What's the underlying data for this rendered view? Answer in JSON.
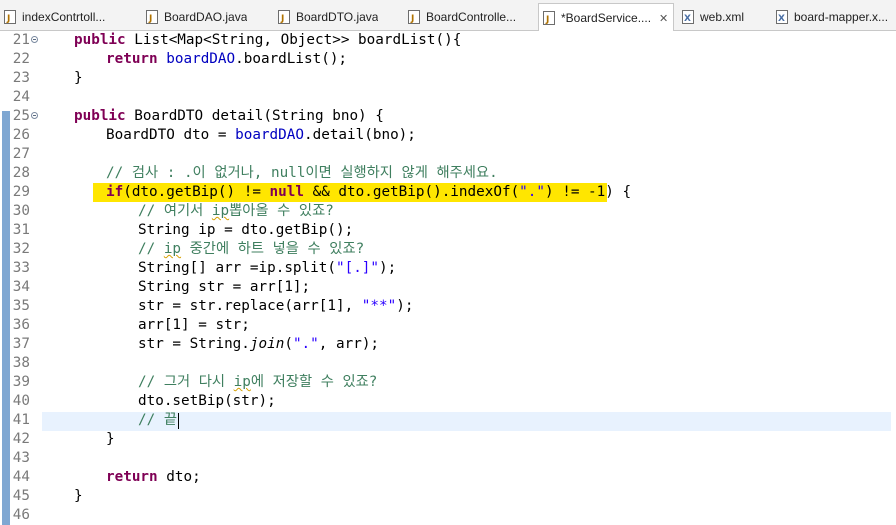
{
  "tabs": [
    {
      "label": "indexContrtoll...",
      "icon": "java-file-icon",
      "active": false
    },
    {
      "label": "BoardDAO.java",
      "icon": "java-file-icon",
      "active": false
    },
    {
      "label": "BoardDTO.java",
      "icon": "java-file-icon",
      "active": false
    },
    {
      "label": "BoardControlle...",
      "icon": "java-file-icon",
      "active": false
    },
    {
      "label": "*BoardService....",
      "icon": "java-file-icon",
      "active": true
    },
    {
      "label": "web.xml",
      "icon": "xml-file-icon",
      "active": false
    },
    {
      "label": "board-mapper.x...",
      "icon": "xml-file-icon",
      "active": false
    }
  ],
  "close_glyph": "✕",
  "lines": [
    {
      "num": "21",
      "fold": true
    },
    {
      "num": "22"
    },
    {
      "num": "23"
    },
    {
      "num": "24"
    },
    {
      "num": "25",
      "fold": true
    },
    {
      "num": "26"
    },
    {
      "num": "27"
    },
    {
      "num": "28"
    },
    {
      "num": "29"
    },
    {
      "num": "30"
    },
    {
      "num": "31"
    },
    {
      "num": "32"
    },
    {
      "num": "33"
    },
    {
      "num": "34"
    },
    {
      "num": "35"
    },
    {
      "num": "36"
    },
    {
      "num": "37"
    },
    {
      "num": "38"
    },
    {
      "num": "39"
    },
    {
      "num": "40"
    },
    {
      "num": "41"
    },
    {
      "num": "42"
    },
    {
      "num": "43"
    },
    {
      "num": "44"
    },
    {
      "num": "45"
    },
    {
      "num": "46"
    }
  ],
  "code": {
    "l21": {
      "kw1": "public",
      "t1": " List<Map<String, Object>> boardList(){"
    },
    "l22": {
      "kw1": "return",
      "fld": "boardDAO",
      "t1": ".boardList();"
    },
    "l23": {
      "t1": "}"
    },
    "l25": {
      "kw1": "public",
      "t1": " BoardDTO detail(String bno) {"
    },
    "l26": {
      "t1": "BoardDTO dto = ",
      "fld": "boardDAO",
      "t2": ".detail(bno);"
    },
    "l28": {
      "cmt": "// 검사 : .이 없거나, null이면 실행하지 않게 해주세요."
    },
    "l29": {
      "kw1": "if",
      "t1": "(dto.getBip() != ",
      "kw2": "null",
      "t2": " && dto.getBip().indexOf(",
      "str": "\".\"",
      "t3": ") != -1) {"
    },
    "l30": {
      "cmt1": "// 여기서 ",
      "sq": "ip",
      "cmt2": "뽑아올 수 있죠?"
    },
    "l31": {
      "t1": "String ip = dto.getBip();"
    },
    "l32": {
      "cmt1": "// ",
      "sq": "ip",
      "cmt2": " 중간에 하트 넣을 수 있죠?"
    },
    "l33": {
      "t1": "String[] arr =ip.split(",
      "str": "\"[.]\"",
      "t2": ");"
    },
    "l34": {
      "t1": "String str = arr[1];"
    },
    "l35": {
      "t1": "str = str.replace(arr[1], ",
      "str": "\"**\"",
      "t2": ");"
    },
    "l36": {
      "t1": "arr[1] = str;"
    },
    "l37": {
      "t1": "str = String.",
      "ital": "join",
      "t2": "(",
      "str": "\".\"",
      "t3": ", arr);"
    },
    "l39": {
      "cmt1": "// 그거 다시 ",
      "sq": "ip",
      "cmt2": "에 저장할 수 있죠?"
    },
    "l40": {
      "t1": "dto.setBip(str);"
    },
    "l41": {
      "cmt": "// 끝"
    },
    "l42": {
      "t1": "}"
    },
    "l44": {
      "kw1": "return",
      "t1": " dto;"
    },
    "l45": {
      "t1": "}"
    }
  },
  "colors": {
    "keyword": "#7f0055",
    "field": "#0000c0",
    "string": "#2a00ff",
    "comment": "#3f7f5f",
    "highlight": "#ffe600",
    "current_line": "#e8f2fe"
  }
}
